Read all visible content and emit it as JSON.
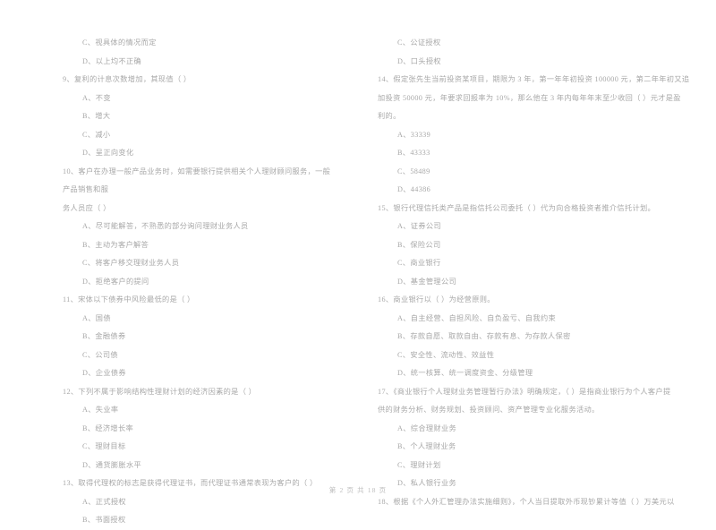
{
  "document": {
    "type": "exam-paper",
    "footer": "第 2 页 共 18 页",
    "page_number": 2,
    "total_pages": 18,
    "text_color": "#a8a8a8",
    "background_color": "#ffffff"
  },
  "left_column": {
    "continued_options": [
      "C、视具体的情况而定",
      "D、以上均不正确"
    ],
    "questions": [
      {
        "number": "9",
        "stem": "9、复利的计息次数增加，其现值（      ）",
        "options": [
          "A、不变",
          "B、增大",
          "C、减小",
          "D、呈正向变化"
        ]
      },
      {
        "number": "10",
        "stem": "10、客户在办理一般产品业务时，如需要银行提供相关个人理财顾问服务，一般产品销售和服",
        "stem_line2": "务人员应（      ）",
        "options": [
          "A、尽可能解答，不熟悉的部分询问理财业务人员",
          "B、主动为客户解答",
          "C、将客户移交理财业务人员",
          "D、拒绝客户的提问"
        ]
      },
      {
        "number": "11",
        "stem": "11、宋体以下债券中风险最低的是（      ）",
        "options": [
          "A、国债",
          "B、金融债券",
          "C、公司债",
          "D、企业债券"
        ]
      },
      {
        "number": "12",
        "stem": "12、下列不属于影响结构性理财计划的经济因素的是（      ）",
        "options": [
          "A、失业率",
          "B、经济增长率",
          "C、理财目标",
          "D、通货膨胀水平"
        ]
      },
      {
        "number": "13",
        "stem": "13、取得代理权的标志是获得代理证书，而代理证书通常表现为客户的（      ）",
        "options": [
          "A、正式授权",
          "B、书面授权"
        ]
      }
    ]
  },
  "right_column": {
    "continued_options": [
      "C、公证授权",
      "D、口头授权"
    ],
    "questions": [
      {
        "number": "14",
        "stem": "14、假定张先生当前投资某项目，期限为 3 年，第一年年初投资 100000 元，第二年年初又追",
        "stem_line2": "加投资 50000 元，年要求回报率为 10%，那么他在 3 年内每年年末至少收回（      ）元才是盈",
        "stem_line3": "利的。",
        "options": [
          "A、33339",
          "B、43333",
          "C、58489",
          "D、44386"
        ]
      },
      {
        "number": "15",
        "stem": "15、银行代理信托类产品是指信托公司委托（      ）代为向合格投资者推介信托计划。",
        "options": [
          "A、证券公司",
          "B、保险公司",
          "C、商业银行",
          "D、基金管理公司"
        ]
      },
      {
        "number": "16",
        "stem": "16、商业银行以（      ）为经营原则。",
        "options": [
          "A、自主经营、自担风险、自负盈亏、自我约束",
          "B、存款自愿、取款自由、存款有息、为存款人保密",
          "C、安全性、流动性、效益性",
          "D、统一核算、统一调度资金、分级管理"
        ]
      },
      {
        "number": "17",
        "stem": "17、《商业银行个人理财业务管理暂行办法》明确规定，（      ）是指商业银行为个人客户提",
        "stem_line2": "供的财务分析、财务规划、投资顾问、资产管理专业化服务活动。",
        "options": [
          "A、综合理财业务",
          "B、个人理财业务",
          "C、理财计划",
          "D、私人银行业务"
        ]
      },
      {
        "number": "18",
        "stem": "18、根据《个人外汇管理办法实施细则》，个人当日提取外币现钞累计等值（      ）万美元以",
        "options": []
      }
    ]
  }
}
